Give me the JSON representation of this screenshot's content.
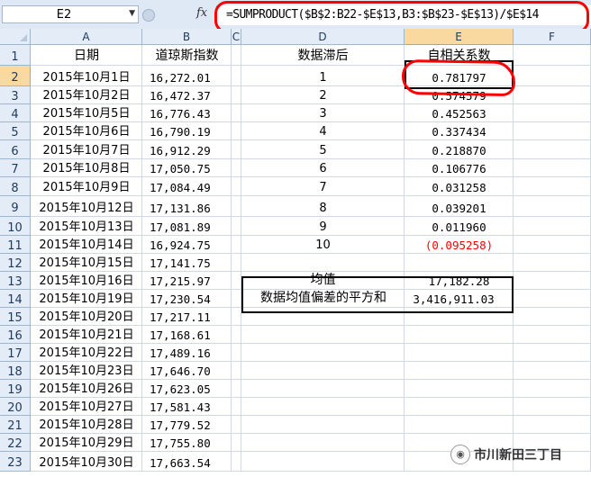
{
  "name_box": "E2",
  "formula": "=SUMPRODUCT($B$2:B22-$E$13,B3:$B$23-$E$13)/$E$14",
  "fx_label": "fx",
  "columns": [
    "A",
    "B",
    "C",
    "D",
    "E",
    "F"
  ],
  "active_column": "E",
  "active_row": 2,
  "header_row": {
    "a": "日期",
    "b": "道琼斯指数",
    "d": "数据滞后",
    "e": "自相关系数"
  },
  "rows": [
    {
      "n": "1",
      "a": "",
      "b": "",
      "d": "",
      "e": ""
    },
    {
      "n": "2",
      "a": "2015年10月1日",
      "b": "16,272.01",
      "d": "1",
      "e": "0.781797"
    },
    {
      "n": "3",
      "a": "2015年10月2日",
      "b": "16,472.37",
      "d": "2",
      "e": "0.574579"
    },
    {
      "n": "4",
      "a": "2015年10月5日",
      "b": "16,776.43",
      "d": "3",
      "e": "0.452563"
    },
    {
      "n": "5",
      "a": "2015年10月6日",
      "b": "16,790.19",
      "d": "4",
      "e": "0.337434"
    },
    {
      "n": "6",
      "a": "2015年10月7日",
      "b": "16,912.29",
      "d": "5",
      "e": "0.218870"
    },
    {
      "n": "7",
      "a": "2015年10月8日",
      "b": "17,050.75",
      "d": "6",
      "e": "0.106776"
    },
    {
      "n": "8",
      "a": "2015年10月9日",
      "b": "17,084.49",
      "d": "7",
      "e": "0.031258"
    },
    {
      "n": "9",
      "a": "2015年10月12日",
      "b": "17,131.86",
      "d": "8",
      "e": "0.039201"
    },
    {
      "n": "10",
      "a": "2015年10月13日",
      "b": "17,081.89",
      "d": "9",
      "e": "0.011960"
    },
    {
      "n": "11",
      "a": "2015年10月14日",
      "b": "16,924.75",
      "d": "10",
      "e": "(0.095258)"
    },
    {
      "n": "12",
      "a": "2015年10月15日",
      "b": "17,141.75",
      "d": "",
      "e": ""
    },
    {
      "n": "13",
      "a": "2015年10月16日",
      "b": "17,215.97",
      "d": "均值",
      "e": "17,182.28"
    },
    {
      "n": "14",
      "a": "2015年10月19日",
      "b": "17,230.54",
      "d": "数据均值偏差的平方和",
      "e": "3,416,911.03"
    },
    {
      "n": "15",
      "a": "2015年10月20日",
      "b": "17,217.11",
      "d": "",
      "e": ""
    },
    {
      "n": "16",
      "a": "2015年10月21日",
      "b": "17,168.61",
      "d": "",
      "e": ""
    },
    {
      "n": "17",
      "a": "2015年10月22日",
      "b": "17,489.16",
      "d": "",
      "e": ""
    },
    {
      "n": "18",
      "a": "2015年10月23日",
      "b": "17,646.70",
      "d": "",
      "e": ""
    },
    {
      "n": "19",
      "a": "2015年10月26日",
      "b": "17,623.05",
      "d": "",
      "e": ""
    },
    {
      "n": "20",
      "a": "2015年10月27日",
      "b": "17,581.43",
      "d": "",
      "e": ""
    },
    {
      "n": "21",
      "a": "2015年10月28日",
      "b": "17,779.52",
      "d": "",
      "e": ""
    },
    {
      "n": "22",
      "a": "2015年10月29日",
      "b": "17,755.80",
      "d": "",
      "e": ""
    },
    {
      "n": "23",
      "a": "2015年10月30日",
      "b": "17,663.54",
      "d": "",
      "e": ""
    }
  ],
  "colors": {
    "negative": "#ff0000",
    "annotation": "#ff0000",
    "header_bg": "#e4ecf7",
    "active_header_bg": "#f9d99f"
  },
  "watermark": "市川新田三丁目"
}
